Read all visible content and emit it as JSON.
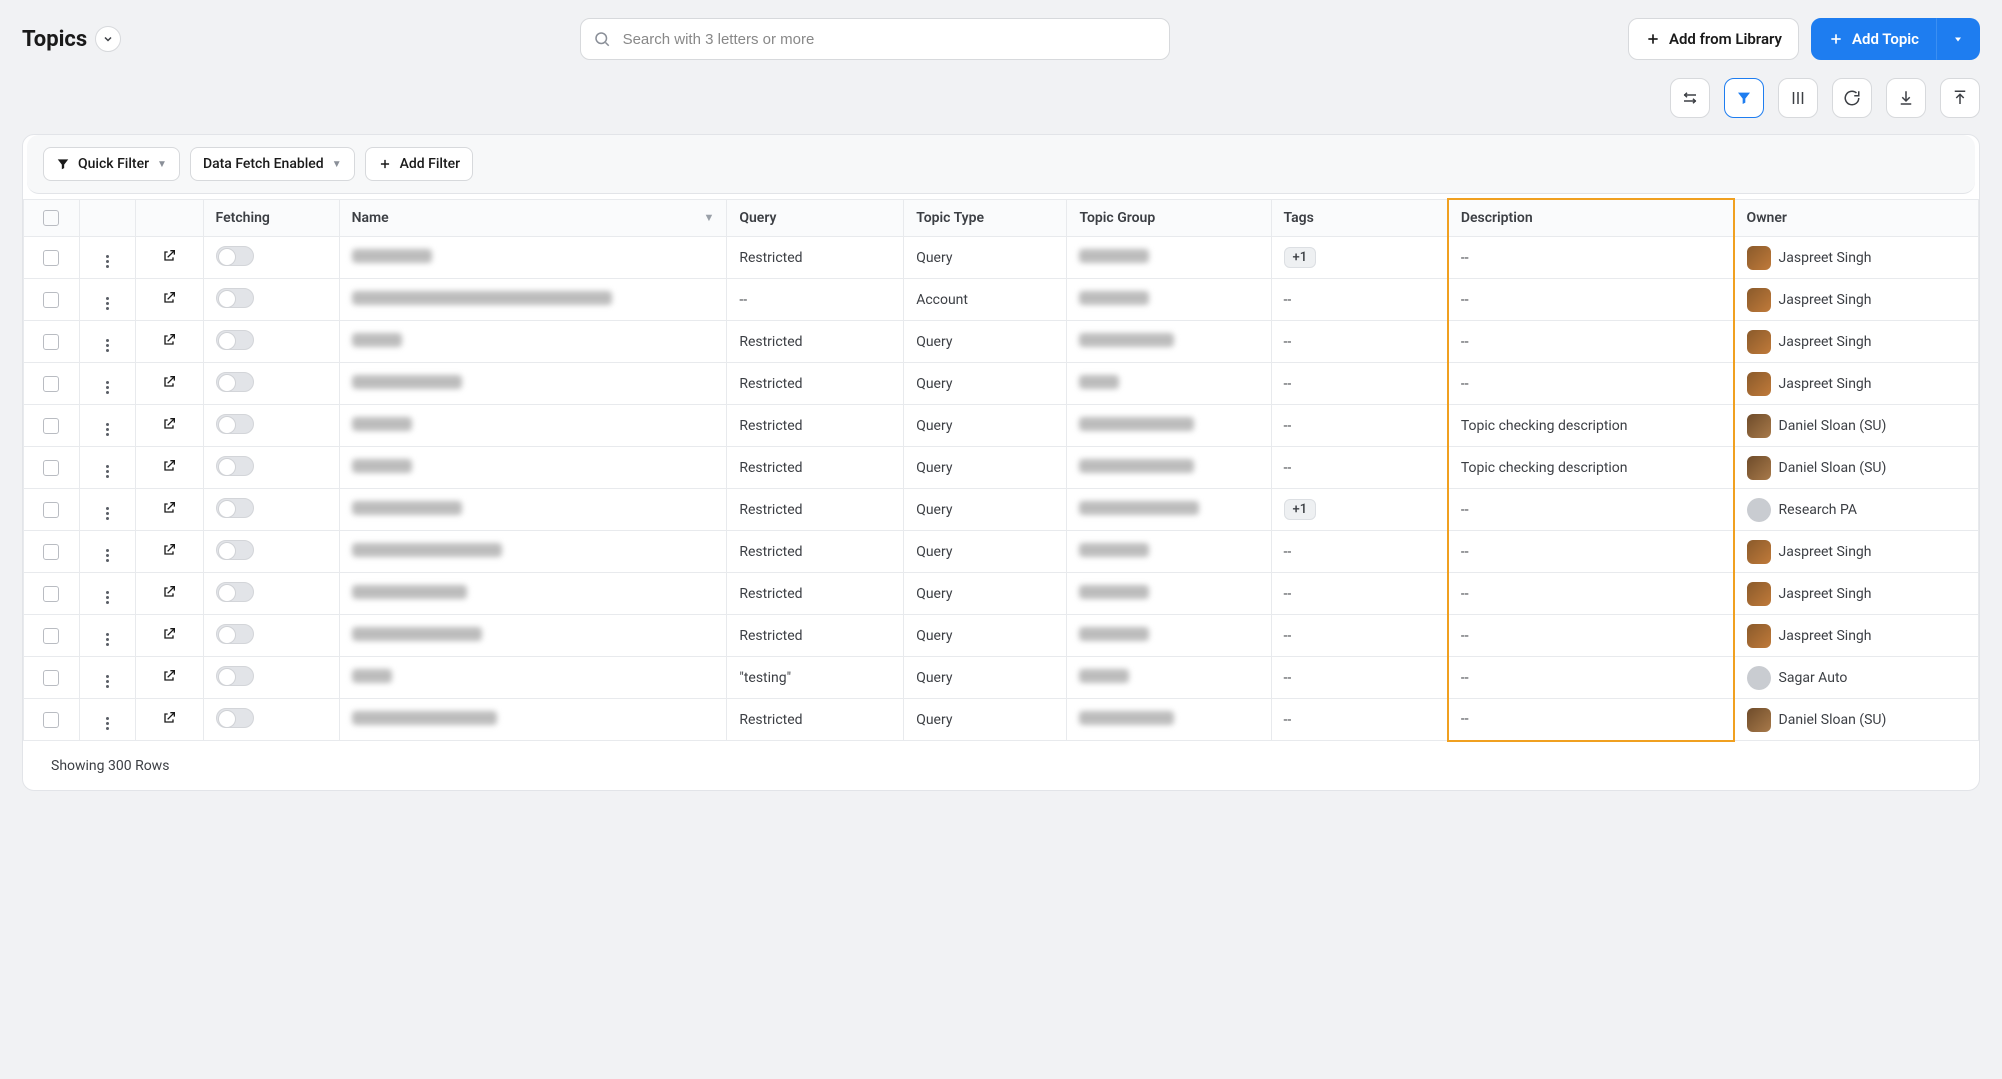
{
  "header": {
    "title": "Topics",
    "search_placeholder": "Search with 3 letters or more",
    "add_from_library": "Add from Library",
    "add_topic": "Add Topic"
  },
  "toolbar_icons": {
    "settings": "settings-sliders-icon",
    "filter": "funnel-icon",
    "columns": "columns-icon",
    "refresh": "refresh-icon",
    "download": "download-icon",
    "upload": "upload-icon"
  },
  "filters": {
    "quick_filter": "Quick Filter",
    "data_fetch": "Data Fetch Enabled",
    "add_filter": "Add Filter"
  },
  "columns": {
    "fetching": "Fetching",
    "name": "Name",
    "query": "Query",
    "topic_type": "Topic Type",
    "topic_group": "Topic Group",
    "tags": "Tags",
    "description": "Description",
    "owner": "Owner"
  },
  "rows": [
    {
      "name_w": 80,
      "query": "Restricted",
      "type": "Query",
      "group_w": 70,
      "tags": "+1",
      "desc": "--",
      "owner": "Jaspreet Singh",
      "avatar": "js",
      "toggle": true
    },
    {
      "name_w": 260,
      "query": "--",
      "type": "Account",
      "group_w": 70,
      "tags": "--",
      "desc": "--",
      "owner": "Jaspreet Singh",
      "avatar": "js",
      "toggle": true
    },
    {
      "name_w": 50,
      "query": "Restricted",
      "type": "Query",
      "group_w": 95,
      "tags": "--",
      "desc": "--",
      "owner": "Jaspreet Singh",
      "avatar": "js",
      "toggle": true
    },
    {
      "name_w": 110,
      "query": "Restricted",
      "type": "Query",
      "group_w": 40,
      "tags": "--",
      "desc": "--",
      "owner": "Jaspreet Singh",
      "avatar": "js",
      "toggle": true
    },
    {
      "name_w": 60,
      "query": "Restricted",
      "type": "Query",
      "group_w": 115,
      "tags": "--",
      "desc": "Topic checking description",
      "owner": "Daniel Sloan (SU)",
      "avatar": "ds",
      "toggle": true
    },
    {
      "name_w": 60,
      "query": "Restricted",
      "type": "Query",
      "group_w": 115,
      "tags": "--",
      "desc": "Topic checking description",
      "owner": "Daniel Sloan (SU)",
      "avatar": "ds",
      "toggle": true
    },
    {
      "name_w": 110,
      "query": "Restricted",
      "type": "Query",
      "group_w": 120,
      "tags": "+1",
      "desc": "--",
      "owner": "Research PA",
      "avatar": "round",
      "toggle": true
    },
    {
      "name_w": 150,
      "query": "Restricted",
      "type": "Query",
      "group_w": 70,
      "tags": "--",
      "desc": "--",
      "owner": "Jaspreet Singh",
      "avatar": "js",
      "toggle": true
    },
    {
      "name_w": 115,
      "query": "Restricted",
      "type": "Query",
      "group_w": 70,
      "tags": "--",
      "desc": "--",
      "owner": "Jaspreet Singh",
      "avatar": "js",
      "toggle": true
    },
    {
      "name_w": 130,
      "query": "Restricted",
      "type": "Query",
      "group_w": 70,
      "tags": "--",
      "desc": "--",
      "owner": "Jaspreet Singh",
      "avatar": "js",
      "toggle": true
    },
    {
      "name_w": 40,
      "query": "\"testing\"",
      "type": "Query",
      "group_w": 50,
      "tags": "--",
      "desc": "--",
      "owner": "Sagar Auto",
      "avatar": "round",
      "toggle": false
    },
    {
      "name_w": 145,
      "query": "Restricted",
      "type": "Query",
      "group_w": 95,
      "tags": "--",
      "desc": "--",
      "owner": "Daniel Sloan (SU)",
      "avatar": "ds",
      "toggle": true
    }
  ],
  "footer": {
    "rows_text": "Showing 300 Rows"
  }
}
